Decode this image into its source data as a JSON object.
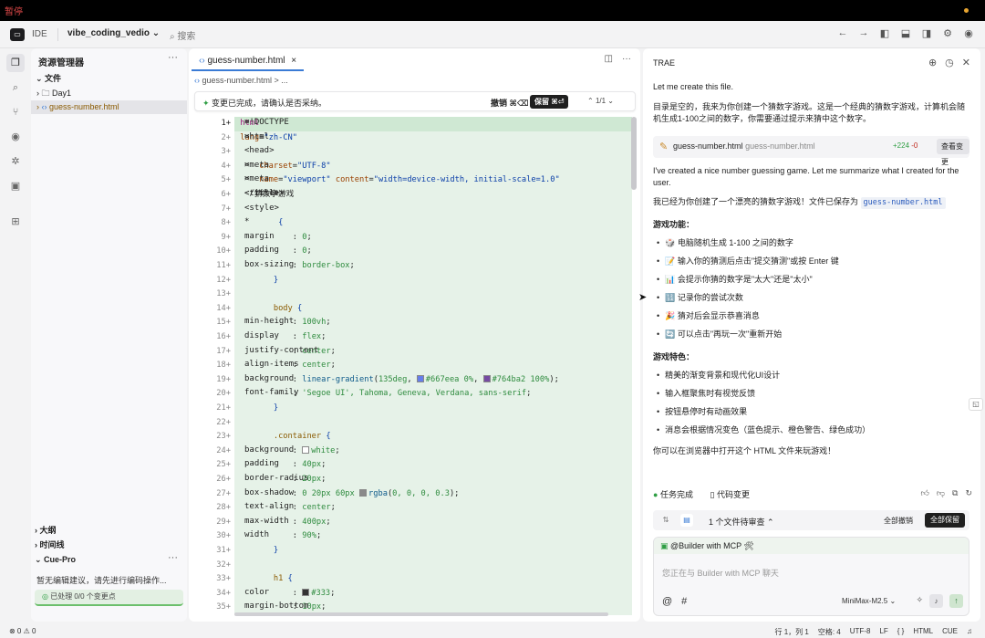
{
  "topbar": {
    "recording_label": "暂停"
  },
  "titlebar": {
    "ide_label": "IDE",
    "project": "vibe_coding_vedio ⌄",
    "search_label": "搜索"
  },
  "explorer": {
    "title": "资源管理器",
    "root": "文件",
    "folder": "Day1",
    "file": "guess-number.html",
    "outline": "大纲",
    "timeline": "时间线",
    "cue_title": "Cue-Pro",
    "cue_message": "暂无编辑建议，请先进行编码操作...",
    "cue_badge": "已处理 0/0 个变更点"
  },
  "editor": {
    "tab_label": "guess-number.html",
    "breadcrumb": "guess-number.html > ...",
    "change_message": "变更已完成，请确认是否采纳。",
    "undo_label": "撤销 ⌘⌫",
    "keep_label": "保留 ⌘⏎",
    "nav_label": "1/1",
    "lines": [
      {
        "n": "1",
        "html": "<span class=\"p\">&lt;!DOCTYPE</span> <span class=\"k\">html</span><span class=\"p\">&gt;</span>"
      },
      {
        "n": "2",
        "html": "<span class=\"p\">&lt;html</span> <span class=\"a\">lang</span>=<span class=\"s\">\"zh-CN\"</span><span class=\"p\">&gt;</span>"
      },
      {
        "n": "3",
        "html": "<span class=\"p\">&lt;head&gt;</span>"
      },
      {
        "n": "4",
        "html": "    <span class=\"p\">&lt;meta</span> <span class=\"a\">charset</span>=<span class=\"s\">\"UTF-8\"</span><span class=\"p\">&gt;</span>"
      },
      {
        "n": "5",
        "html": "    <span class=\"p\">&lt;meta</span> <span class=\"a\">name</span>=<span class=\"s\">\"viewport\"</span> <span class=\"a\">content</span>=<span class=\"s\">\"width=device-width, initial-scale=1.0\"</span><span class=\"p\">&gt;</span>"
      },
      {
        "n": "6",
        "html": "    <span class=\"p\">&lt;title&gt;</span>猜数字游戏<span class=\"p\">&lt;/title&gt;</span>"
      },
      {
        "n": "7",
        "html": "    <span class=\"p\">&lt;style&gt;</span>"
      },
      {
        "n": "8",
        "html": "        <span class=\"p\">*</span> <span class=\"s\">{</span>"
      },
      {
        "n": "9",
        "html": "            <span class=\"p\">margin</span>: <span class=\"n\">0</span>;"
      },
      {
        "n": "10",
        "html": "            <span class=\"p\">padding</span>: <span class=\"n\">0</span>;"
      },
      {
        "n": "11",
        "html": "            <span class=\"p\">box-sizing</span>: <span class=\"n\">border-box</span>;"
      },
      {
        "n": "12",
        "html": "        <span class=\"s\">}</span>"
      },
      {
        "n": "13",
        "html": ""
      },
      {
        "n": "14",
        "html": "        <span class=\"sel\">body</span> <span class=\"s\">{</span>"
      },
      {
        "n": "15",
        "html": "            <span class=\"p\">min-height</span>: <span class=\"n\">100vh</span>;"
      },
      {
        "n": "16",
        "html": "            <span class=\"p\">display</span>: <span class=\"n\">flex</span>;"
      },
      {
        "n": "17",
        "html": "            <span class=\"p\">justify-content</span>: <span class=\"n\">center</span>;"
      },
      {
        "n": "18",
        "html": "            <span class=\"p\">align-items</span>: <span class=\"n\">center</span>;"
      },
      {
        "n": "19",
        "html": "            <span class=\"p\">background</span>: <span class=\"v\">linear-gradient</span>(<span class=\"n\">135deg</span>, <span class=\"sw\" style=\"background:#667eea\"></span><span class=\"n\">#667eea 0%</span>, <span class=\"sw\" style=\"background:#764ba2\"></span><span class=\"n\">#764ba2 100%</span>);"
      },
      {
        "n": "20",
        "html": "            <span class=\"p\">font-family</span>: <span class=\"n\">'Segoe UI', Tahoma, Geneva, Verdana, sans-serif</span>;"
      },
      {
        "n": "21",
        "html": "        <span class=\"s\">}</span>"
      },
      {
        "n": "22",
        "html": ""
      },
      {
        "n": "23",
        "html": "        <span class=\"sel\">.container</span> <span class=\"s\">{</span>"
      },
      {
        "n": "24",
        "html": "            <span class=\"p\">background</span>: <span class=\"sw\" style=\"background:#fff\"></span><span class=\"n\">white</span>;"
      },
      {
        "n": "25",
        "html": "            <span class=\"p\">padding</span>: <span class=\"n\">40px</span>;"
      },
      {
        "n": "26",
        "html": "            <span class=\"p\">border-radius</span>: <span class=\"n\">20px</span>;"
      },
      {
        "n": "27",
        "html": "            <span class=\"p\">box-shadow</span>: <span class=\"n\">0 20px 60px</span> <span class=\"sw\" style=\"background:#8a8a8a\"></span><span class=\"v\">rgba</span>(<span class=\"n\">0, 0, 0, 0.3</span>);"
      },
      {
        "n": "28",
        "html": "            <span class=\"p\">text-align</span>: <span class=\"n\">center</span>;"
      },
      {
        "n": "29",
        "html": "            <span class=\"p\">max-width</span>: <span class=\"n\">400px</span>;"
      },
      {
        "n": "30",
        "html": "            <span class=\"p\">width</span>: <span class=\"n\">90%</span>;"
      },
      {
        "n": "31",
        "html": "        <span class=\"s\">}</span>"
      },
      {
        "n": "32",
        "html": ""
      },
      {
        "n": "33",
        "html": "        <span class=\"sel\">h1</span> <span class=\"s\">{</span>"
      },
      {
        "n": "34",
        "html": "            <span class=\"p\">color</span>: <span class=\"sw\" style=\"background:#333\"></span><span class=\"n\">#333</span>;"
      },
      {
        "n": "35",
        "html": "            <span class=\"p\">margin-bottom</span>: <span class=\"n\">10px</span>;"
      }
    ]
  },
  "chat": {
    "title": "TRAE",
    "intro": "Let me create this file.",
    "desc": "目录是空的，我来为你创建一个猜数字游戏。这是一个经典的猜数字游戏，计算机会随机生成1-100之间的数字，你需要通过提示来猜中这个数字。",
    "file_name": "guess-number.html",
    "file_path": "guess-number.html",
    "added": "+224",
    "removed": "-0",
    "view_changes": "查看变更",
    "summary_en": "I've created a nice number guessing game. Let me summarize what I created for the user.",
    "summary_zh": "我已经为你创建了一个漂亮的猜数字游戏！文件已保存为",
    "summary_file": "guess-number.html",
    "features_title": "游戏功能：",
    "features": [
      "🎲 电脑随机生成 1-100 之间的数字",
      "📝 输入你的猜测后点击\"提交猜测\"或按 Enter 键",
      "📊 会提示你猜的数字是\"太大\"还是\"太小\"",
      "🔢 记录你的尝试次数",
      "🎉 猜对后会显示恭喜消息",
      "🔄 可以点击\"再玩一次\"重新开始"
    ],
    "traits_title": "游戏特色：",
    "traits": [
      "精美的渐变背景和现代化UI设计",
      "输入框聚焦时有视觉反馈",
      "按钮悬停时有动画效果",
      "消息会根据情况变色（蓝色提示、橙色警告、绿色成功）"
    ],
    "closing": "你可以在浏览器中打开这个 HTML 文件来玩游戏！",
    "task_done": "任务完成",
    "code_changes": "代码变更",
    "review_label": "1 个文件待审查 ⌃",
    "undo_all": "全部撤销",
    "keep_all": "全部保留",
    "agent": "@Builder with MCP 🛠",
    "placeholder": "您正在与 Builder with MCP 聊天",
    "model": "MiniMax-M2.5 ⌄"
  },
  "status": {
    "problems": "⊗ 0 ⚠ 0",
    "position": "行 1，列 1",
    "spaces": "空格: 4",
    "encoding": "UTF-8",
    "eol": "LF",
    "brackets": "{ }",
    "language": "HTML",
    "cue": "CUE"
  }
}
